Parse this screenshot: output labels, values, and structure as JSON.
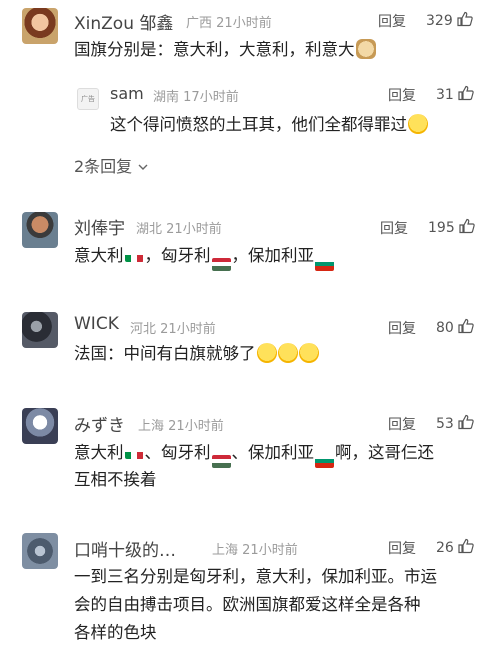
{
  "comments": [
    {
      "user": "XinZou 邹鑫",
      "location": "广西",
      "time": "21小时前",
      "reply_label": "回复",
      "likes": "329",
      "content": "国旗分别是：意大利，大意利，利意大",
      "avatar_icon": "user-avatar-icon",
      "subreply": {
        "avatar_tag": "广告",
        "user": "sam",
        "location": "湖南",
        "time": "17小时前",
        "reply_label": "回复",
        "likes": "31",
        "content": "这个得问愤怒的土耳其，他们全都得罪过"
      },
      "expand_label": "2条回复"
    },
    {
      "user": "刘俸宇",
      "location": "湖北",
      "time": "21小时前",
      "reply_label": "回复",
      "likes": "195",
      "content_parts": [
        "意大利",
        "，匈牙利",
        "，保加利亚"
      ]
    },
    {
      "user": "WICK",
      "location": "河北",
      "time": "21小时前",
      "reply_label": "回复",
      "likes": "80",
      "content": "法国：中间有白旗就够了"
    },
    {
      "user": "みずき",
      "location": "上海",
      "time": "21小时前",
      "reply_label": "回复",
      "likes": "53",
      "content_parts": [
        "意大利",
        "、匈牙利",
        "、保加利亚",
        "啊，这哥仨还"
      ],
      "content_line2": "互相不挨着"
    },
    {
      "user": "口哨十级的…",
      "location": "上海",
      "time": "21小时前",
      "reply_label": "回复",
      "likes": "26",
      "content_lines": [
        "一到三名分别是匈牙利，意大利，保加利亚。市运",
        "会的自由搏击项目。欧洲国旗都爱这样全是各种",
        "各样的色块"
      ]
    }
  ],
  "colors": {
    "italy": [
      "#009246",
      "#ffffff",
      "#ce2b37"
    ],
    "hungary": [
      "#ce2939",
      "#ffffff",
      "#477050"
    ],
    "bulgaria": [
      "#ffffff",
      "#00966e",
      "#d62612"
    ]
  }
}
